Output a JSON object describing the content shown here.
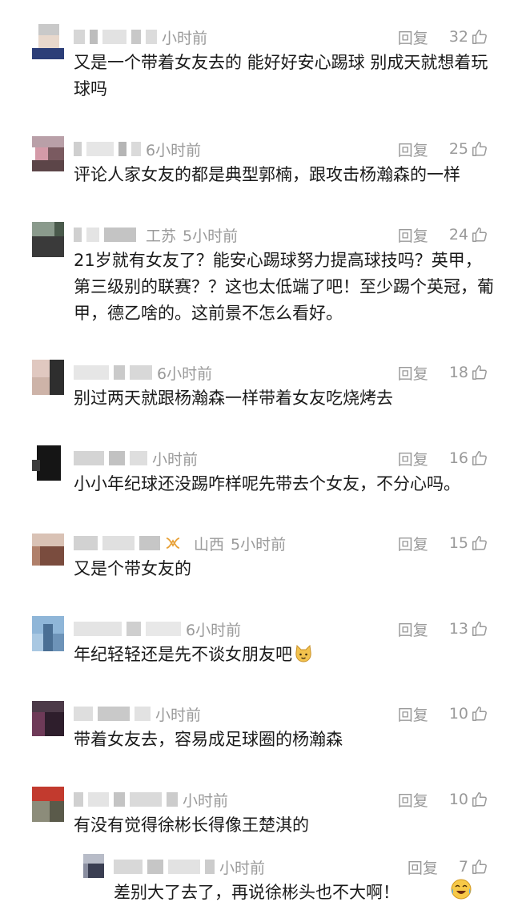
{
  "comments": [
    {
      "time": "小时前",
      "location": "",
      "reply_label": "回复",
      "likes": "32",
      "text": "又是一个带着女友去的 能好好安心踢球 别成天就想着玩球吗"
    },
    {
      "time": "6小时前",
      "location": "",
      "reply_label": "回复",
      "likes": "25",
      "text": "评论人家女友的都是典型郭楠，跟攻击杨瀚森的一样"
    },
    {
      "time": "5小时前",
      "location": "工苏",
      "reply_label": "回复",
      "likes": "24",
      "text": "21岁就有女友了？能安心踢球努力提高球技吗？英甲，第三级别的联赛？？这也太低端了吧！至少踢个英冠，葡甲，德乙啥的。这前景不怎么看好。"
    },
    {
      "time": "6小时前",
      "location": "",
      "reply_label": "回复",
      "likes": "18",
      "text": "别过两天就跟杨瀚森一样带着女友吃烧烤去"
    },
    {
      "time": "小时前",
      "location": "",
      "reply_label": "回复",
      "likes": "16",
      "text": "小小年纪球还没踢咋样呢先带去个女友，不分心吗。"
    },
    {
      "time": "5小时前",
      "location": "山西",
      "reply_label": "回复",
      "likes": "15",
      "text": "又是个带女友的"
    },
    {
      "time": "6小时前",
      "location": "",
      "reply_label": "回复",
      "likes": "13",
      "text": "年纪轻轻还是先不谈女朋友吧"
    },
    {
      "time": "小时前",
      "location": "",
      "reply_label": "回复",
      "likes": "10",
      "text": "带着女友去，容易成足球圈的杨瀚森"
    },
    {
      "time": "小时前",
      "location": "",
      "reply_label": "回复",
      "likes": "10",
      "text": "有没有觉得徐彬长得像王楚淇的"
    }
  ],
  "reply": {
    "time": "小时前",
    "reply_label": "回复",
    "likes": "7",
    "text": "差别大了去了，再说徐彬头也不大啊！"
  },
  "icons": {
    "like": "thumbs-up-outline-icon",
    "emoji_cat": "cat-face-emoji-icon",
    "emoji_laugh": "laughing-crying-emoji-icon",
    "badge": "fan-badge-icon"
  },
  "colors": {
    "meta_gray": "#9a9a9a",
    "text": "#1a1a1a",
    "background": "#ffffff"
  }
}
